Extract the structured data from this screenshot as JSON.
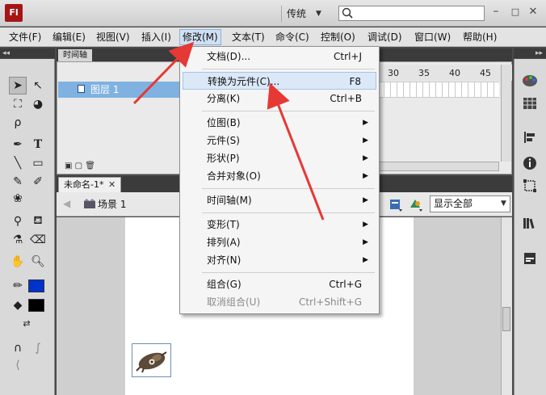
{
  "app": {
    "logo_text": "Fl",
    "workspace": "传统",
    "search_placeholder": "",
    "brand_color": "#a51515"
  },
  "menubar": {
    "items": [
      {
        "label": "文件(F)"
      },
      {
        "label": "编辑(E)"
      },
      {
        "label": "视图(V)"
      },
      {
        "label": "插入(I)"
      },
      {
        "label": "修改(M)"
      },
      {
        "label": "文本(T)"
      },
      {
        "label": "命令(C)"
      },
      {
        "label": "控制(O)"
      },
      {
        "label": "调试(D)"
      },
      {
        "label": "窗口(W)"
      },
      {
        "label": "帮助(H)"
      }
    ],
    "active": "修改(M)"
  },
  "timeline": {
    "tab_label": "时间轴",
    "layer_name": "图层 1",
    "ruler": [
      "30",
      "35",
      "40",
      "45"
    ]
  },
  "document": {
    "tab_label": "未命名-1*",
    "scene_label": "场景 1",
    "zoom": "显示全部"
  },
  "modify_menu": {
    "items": [
      {
        "label": "文档(D)...",
        "shortcut": "Ctrl+J",
        "submenu": false,
        "disabled": false,
        "highlighted": false
      },
      {
        "label": "转换为元件(C)...",
        "shortcut": "F8",
        "submenu": false,
        "disabled": false,
        "highlighted": true
      },
      {
        "label": "分离(K)",
        "shortcut": "Ctrl+B",
        "submenu": false,
        "disabled": false,
        "highlighted": false
      },
      {
        "label": "位图(B)",
        "shortcut": "",
        "submenu": true,
        "disabled": false,
        "highlighted": false
      },
      {
        "label": "元件(S)",
        "shortcut": "",
        "submenu": true,
        "disabled": false,
        "highlighted": false
      },
      {
        "label": "形状(P)",
        "shortcut": "",
        "submenu": true,
        "disabled": false,
        "highlighted": false
      },
      {
        "label": "合并对象(O)",
        "shortcut": "",
        "submenu": true,
        "disabled": false,
        "highlighted": false
      },
      {
        "label": "时间轴(M)",
        "shortcut": "",
        "submenu": true,
        "disabled": false,
        "highlighted": false
      },
      {
        "label": "变形(T)",
        "shortcut": "",
        "submenu": true,
        "disabled": false,
        "highlighted": false
      },
      {
        "label": "排列(A)",
        "shortcut": "",
        "submenu": true,
        "disabled": false,
        "highlighted": false
      },
      {
        "label": "对齐(N)",
        "shortcut": "",
        "submenu": true,
        "disabled": false,
        "highlighted": false
      },
      {
        "label": "组合(G)",
        "shortcut": "Ctrl+G",
        "submenu": false,
        "disabled": false,
        "highlighted": false
      },
      {
        "label": "取消组合(U)",
        "shortcut": "Ctrl+Shift+G",
        "submenu": false,
        "disabled": true,
        "highlighted": false
      }
    ]
  },
  "colors": {
    "stroke_color": "#0033cc",
    "fill_color": "#000000",
    "annotation_arrow": "#e53935",
    "layer_highlight": "#7fb2e0"
  },
  "icons": {
    "tools": [
      "selection-tool-icon",
      "subselection-tool-icon",
      "free-transform-icon",
      "3d-rotation-icon",
      "lasso-icon",
      "pen-icon",
      "text-tool-icon",
      "line-tool-icon",
      "rectangle-tool-icon",
      "pencil-icon",
      "brush-icon",
      "deco-icon",
      "bone-icon",
      "paint-bucket-icon",
      "eyedropper-icon",
      "eraser-icon",
      "hand-icon",
      "zoom-icon",
      "stroke-color-icon",
      "fill-color-icon",
      "swap-colors-icon",
      "snap-icon",
      "smooth-icon",
      "straighten-icon"
    ]
  }
}
